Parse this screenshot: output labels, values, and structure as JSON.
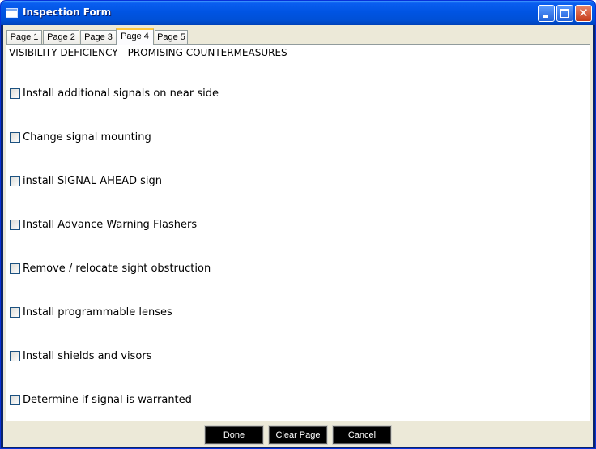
{
  "window": {
    "title": "Inspection Form",
    "close_glyph": "✕"
  },
  "tabs": [
    {
      "label": "Page 1",
      "active": false
    },
    {
      "label": "Page 2",
      "active": false
    },
    {
      "label": "Page 3",
      "active": false
    },
    {
      "label": "Page 4",
      "active": true
    },
    {
      "label": "Page 5",
      "active": false
    }
  ],
  "panel": {
    "heading": "VISIBILITY DEFICIENCY  -  PROMISING COUNTERMEASURES",
    "items": [
      {
        "label": "Install additional signals on near side",
        "checked": false
      },
      {
        "label": "Change signal mounting",
        "checked": false
      },
      {
        "label": "install SIGNAL AHEAD sign",
        "checked": false
      },
      {
        "label": "Install Advance Warning Flashers",
        "checked": false
      },
      {
        "label": "Remove / relocate sight obstruction",
        "checked": false
      },
      {
        "label": "Install programmable lenses",
        "checked": false
      },
      {
        "label": "Install shields and visors",
        "checked": false
      },
      {
        "label": "Determine if signal is warranted",
        "checked": false
      }
    ]
  },
  "buttons": {
    "done": "Done",
    "clear_page": "Clear Page",
    "cancel": "Cancel"
  }
}
